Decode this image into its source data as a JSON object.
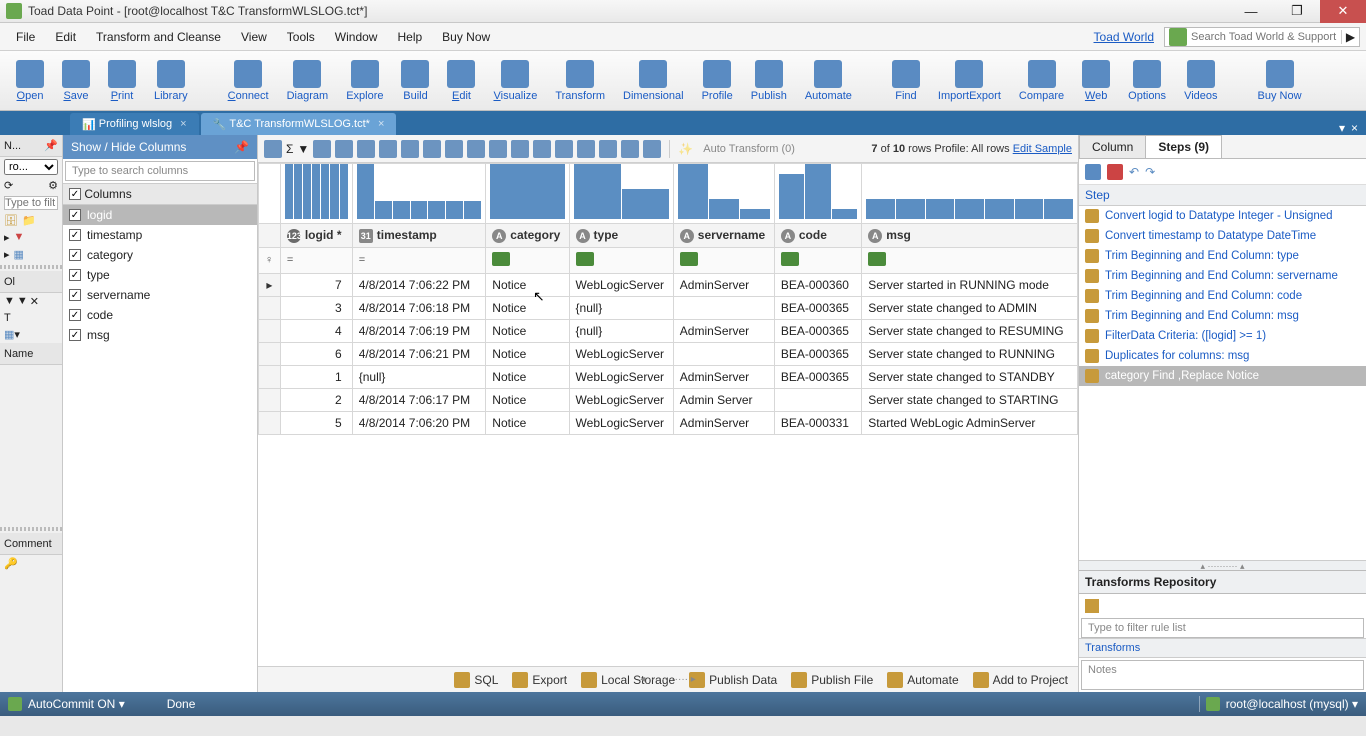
{
  "titlebar": {
    "text": "Toad Data Point - [root@localhost T&C  TransformWLSLOG.tct*]"
  },
  "menu": {
    "items": [
      "File",
      "Edit",
      "Transform and Cleanse",
      "View",
      "Tools",
      "Window",
      "Help",
      "Buy Now"
    ],
    "link": "Toad World",
    "search_placeholder": "Search Toad World & Support"
  },
  "ribbon": {
    "items": [
      "Open",
      "Save",
      "Print",
      "Library",
      "Connect",
      "Diagram",
      "Explore",
      "Build",
      "Edit",
      "Visualize",
      "Transform",
      "Dimensional",
      "Profile",
      "Publish",
      "Automate",
      "Find",
      "ImportExport",
      "Compare",
      "Web",
      "Options",
      "Videos",
      "Buy Now"
    ],
    "underline": {
      "0": "O",
      "1": "S",
      "2": "P",
      "4": "C",
      "8": "E",
      "9": "V",
      "18": "W"
    }
  },
  "tabs": {
    "items": [
      {
        "label": "Profiling wlslog",
        "active": false
      },
      {
        "label": "T&C  TransformWLSLOG.tct*",
        "active": true
      }
    ]
  },
  "leftgutter": {
    "hdr": "N...",
    "tab": "T",
    "sel": "ro...",
    "filter_placeholder": "Type to filt",
    "name": "Name",
    "ol": "Ol",
    "comment": "Comment"
  },
  "columns_panel": {
    "title": "Show / Hide Columns",
    "search_placeholder": "Type to search columns",
    "group": "Columns",
    "items": [
      "logid",
      "timestamp",
      "category",
      "type",
      "servername",
      "code",
      "msg"
    ],
    "selected": "logid"
  },
  "grid": {
    "columns": [
      {
        "key": "logid",
        "label": "logid *",
        "type": "num"
      },
      {
        "key": "timestamp",
        "label": "timestamp",
        "type": "date"
      },
      {
        "key": "category",
        "label": "category",
        "type": "text"
      },
      {
        "key": "type",
        "label": "type",
        "type": "text"
      },
      {
        "key": "servername",
        "label": "servername",
        "type": "text"
      },
      {
        "key": "code",
        "label": "code",
        "type": "text"
      },
      {
        "key": "msg",
        "label": "msg",
        "type": "text"
      }
    ],
    "filter_ops": [
      "=",
      "=",
      "",
      "",
      "",
      "",
      ""
    ],
    "rows": [
      {
        "logid": "7",
        "timestamp": "4/8/2014 7:06:22 PM",
        "category": "Notice",
        "type": "WebLogicServer",
        "servername": "AdminServer",
        "code": "BEA-000360",
        "msg": "Server started in RUNNING mode"
      },
      {
        "logid": "3",
        "timestamp": "4/8/2014 7:06:18 PM",
        "category": "Notice",
        "type": "{null}",
        "servername": "",
        "code": "BEA-000365",
        "msg": "Server state changed to ADMIN"
      },
      {
        "logid": "4",
        "timestamp": "4/8/2014 7:06:19 PM",
        "category": "Notice",
        "type": "{null}",
        "servername": "AdminServer",
        "code": "BEA-000365",
        "msg": "Server state changed to RESUMING"
      },
      {
        "logid": "6",
        "timestamp": "4/8/2014 7:06:21 PM",
        "category": "Notice",
        "type": "WebLogicServer",
        "servername": "",
        "code": "BEA-000365",
        "msg": "Server state changed to RUNNING"
      },
      {
        "logid": "1",
        "timestamp": "{null}",
        "category": "Notice",
        "type": "WebLogicServer",
        "servername": "AdminServer",
        "code": "BEA-000365",
        "msg": "Server state changed to STANDBY"
      },
      {
        "logid": "2",
        "timestamp": "4/8/2014 7:06:17 PM",
        "category": "Notice",
        "type": "WebLogicServer",
        "servername": "Admin Server",
        "code": "",
        "msg": "Server state changed to STARTING"
      },
      {
        "logid": "5",
        "timestamp": "4/8/2014 7:06:20 PM",
        "category": "Notice",
        "type": "WebLogicServer",
        "servername": "AdminServer",
        "code": "BEA-000331",
        "msg": "Started WebLogic AdminServer"
      }
    ],
    "hist": {
      "logid": [
        55,
        55,
        55,
        55,
        55,
        55,
        55
      ],
      "timestamp": [
        55,
        18,
        18,
        18,
        18,
        18,
        18
      ],
      "category": [
        55
      ],
      "type": [
        55,
        30
      ],
      "servername": [
        55,
        20,
        10
      ],
      "code": [
        45,
        55,
        10
      ],
      "msg": [
        20,
        20,
        20,
        20,
        20,
        20,
        20
      ]
    },
    "rowcount_text": {
      "shown": "7",
      "total": "10",
      "suffix": "rows  Profile: All rows ",
      "link": "Edit Sample"
    },
    "auto_transform": "Auto Transform (0)"
  },
  "bottom": {
    "items": [
      "SQL",
      "Export",
      "Local Storage",
      "Publish Data",
      "Publish File",
      "Automate",
      "Add to Project"
    ]
  },
  "right": {
    "tabs": {
      "column": "Column",
      "steps": "Steps (9)"
    },
    "step_header": "Step",
    "steps": [
      "Convert logid to Datatype Integer - Unsigned",
      "Convert timestamp to Datatype DateTime",
      "Trim Beginning and End Column: type",
      "Trim Beginning and End Column: servername",
      "Trim Beginning and End Column: code",
      "Trim Beginning and End Column: msg",
      "FilterData Criteria: ([logid] >= 1)",
      "Duplicates for columns: msg",
      "category Find ,Replace Notice"
    ],
    "selected_step": 8,
    "repository_title": "Transforms Repository",
    "filter_placeholder": "Type to filter rule list",
    "transforms_label": "Transforms",
    "notes_placeholder": "Notes"
  },
  "status": {
    "autocommit": "AutoCommit ON",
    "done": "Done",
    "conn": "root@localhost (mysql)"
  }
}
